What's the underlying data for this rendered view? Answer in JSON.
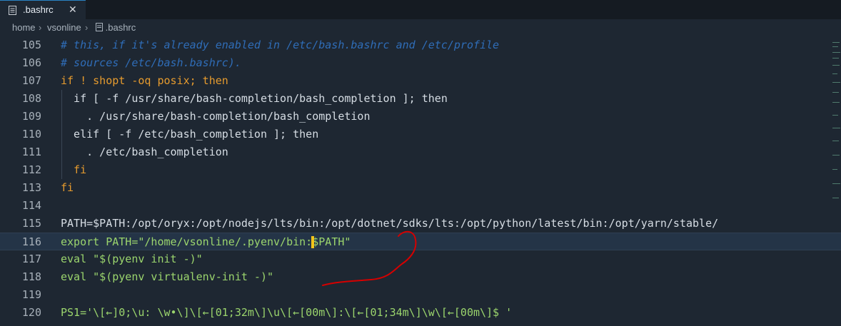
{
  "tab": {
    "label": ".bashrc",
    "close": "✕",
    "icon": "list-file-icon"
  },
  "breadcrumb": {
    "items": [
      "home",
      "vsonline",
      ".bashrc"
    ],
    "separator": "›"
  },
  "colors": {
    "comment": "#2f6db8",
    "keyword": "#e69b2e",
    "string": "#9bd56d",
    "annotation": "#d60000"
  },
  "lines": [
    {
      "num": "105",
      "text": "# this, if it's already enabled in /etc/bash.bashrc and /etc/profile"
    },
    {
      "num": "106",
      "text": "# sources /etc/bash.bashrc)."
    },
    {
      "num": "107",
      "text": "if ! shopt -oq posix; then"
    },
    {
      "num": "108",
      "text": "  if [ -f /usr/share/bash-completion/bash_completion ]; then"
    },
    {
      "num": "109",
      "text": "    . /usr/share/bash-completion/bash_completion"
    },
    {
      "num": "110",
      "text": "  elif [ -f /etc/bash_completion ]; then"
    },
    {
      "num": "111",
      "text": "    . /etc/bash_completion"
    },
    {
      "num": "112",
      "text": "  fi"
    },
    {
      "num": "113",
      "text": "fi"
    },
    {
      "num": "114",
      "text": ""
    },
    {
      "num": "115",
      "text": "PATH=$PATH:/opt/oryx:/opt/nodejs/lts/bin:/opt/dotnet/sdks/lts:/opt/python/latest/bin:/opt/yarn/stable/"
    },
    {
      "num": "116",
      "text": "export PATH=\"/home/vsonline/.pyenv/bin:$PATH\""
    },
    {
      "num": "117",
      "text": "eval \"$(pyenv init -)\""
    },
    {
      "num": "118",
      "text": "eval \"$(pyenv virtualenv-init -)\""
    },
    {
      "num": "119",
      "text": ""
    },
    {
      "num": "120",
      "text": "PS1='\\[←]0;\\u: \\w•\\]\\[←[01;32m\\]\\u\\[←[00m\\]:\\[←[01;34m\\]\\w\\[←[00m\\]$ '"
    }
  ]
}
